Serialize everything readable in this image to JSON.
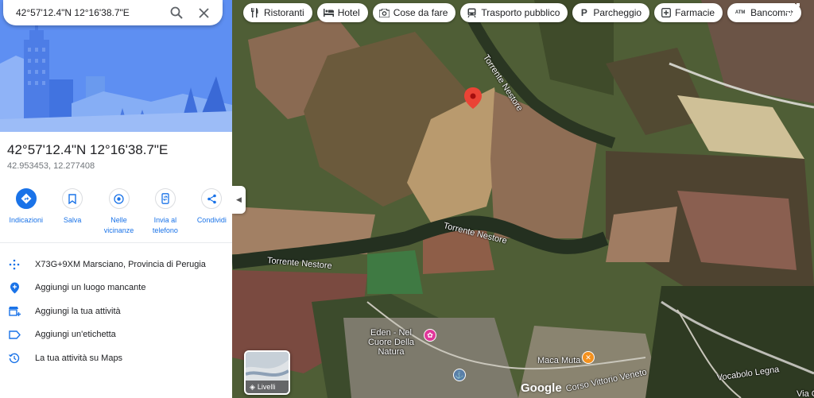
{
  "search": {
    "query": "42°57'12.4\"N 12°16'38.7\"E"
  },
  "place": {
    "title": "42°57'12.4\"N 12°16'38.7\"E",
    "coordinates": "42.953453, 12.277408"
  },
  "actions": [
    {
      "label": "Indicazioni",
      "icon": "directions-icon"
    },
    {
      "label": "Salva",
      "icon": "bookmark-icon"
    },
    {
      "label": "Nelle vicinanze",
      "icon": "nearby-icon"
    },
    {
      "label": "Invia al telefono",
      "icon": "send-to-phone-icon"
    },
    {
      "label": "Condividi",
      "icon": "share-icon"
    }
  ],
  "info_rows": [
    {
      "text": "X73G+9XM Marsciano, Provincia di Perugia",
      "icon": "plus-code-icon"
    },
    {
      "text": "Aggiungi un luogo mancante",
      "icon": "add-place-icon"
    },
    {
      "text": "Aggiungi la tua attività",
      "icon": "add-business-icon"
    },
    {
      "text": "Aggiungi un'etichetta",
      "icon": "label-icon"
    },
    {
      "text": "La tua attività su Maps",
      "icon": "history-icon"
    }
  ],
  "chips": [
    {
      "label": "Ristoranti",
      "icon": "restaurant-icon"
    },
    {
      "label": "Hotel",
      "icon": "hotel-icon"
    },
    {
      "label": "Cose da fare",
      "icon": "camera-icon"
    },
    {
      "label": "Trasporto pubblico",
      "icon": "transit-icon"
    },
    {
      "label": "Parcheggio",
      "icon": "parking-icon"
    },
    {
      "label": "Farmacie",
      "icon": "pharmacy-icon"
    },
    {
      "label": "Bancomat",
      "icon": "atm-icon"
    }
  ],
  "map": {
    "river_labels": [
      "Torrente Nestore",
      "Torrente Nestore",
      "Torrente Nestore"
    ],
    "poi_eden": "Eden - Nel Cuore Della Natura",
    "poi_maca": "Maca Muta",
    "roads": [
      "Corso Vittorio Veneto",
      "Vocabolo Legna",
      "Via G"
    ],
    "layers_label": "Livelli",
    "attribution": "Google"
  },
  "colors": {
    "accent": "#1a73e8",
    "pin": "#ea4335",
    "poi_pink": "#e0379a",
    "poi_orange": "#f4911e"
  }
}
